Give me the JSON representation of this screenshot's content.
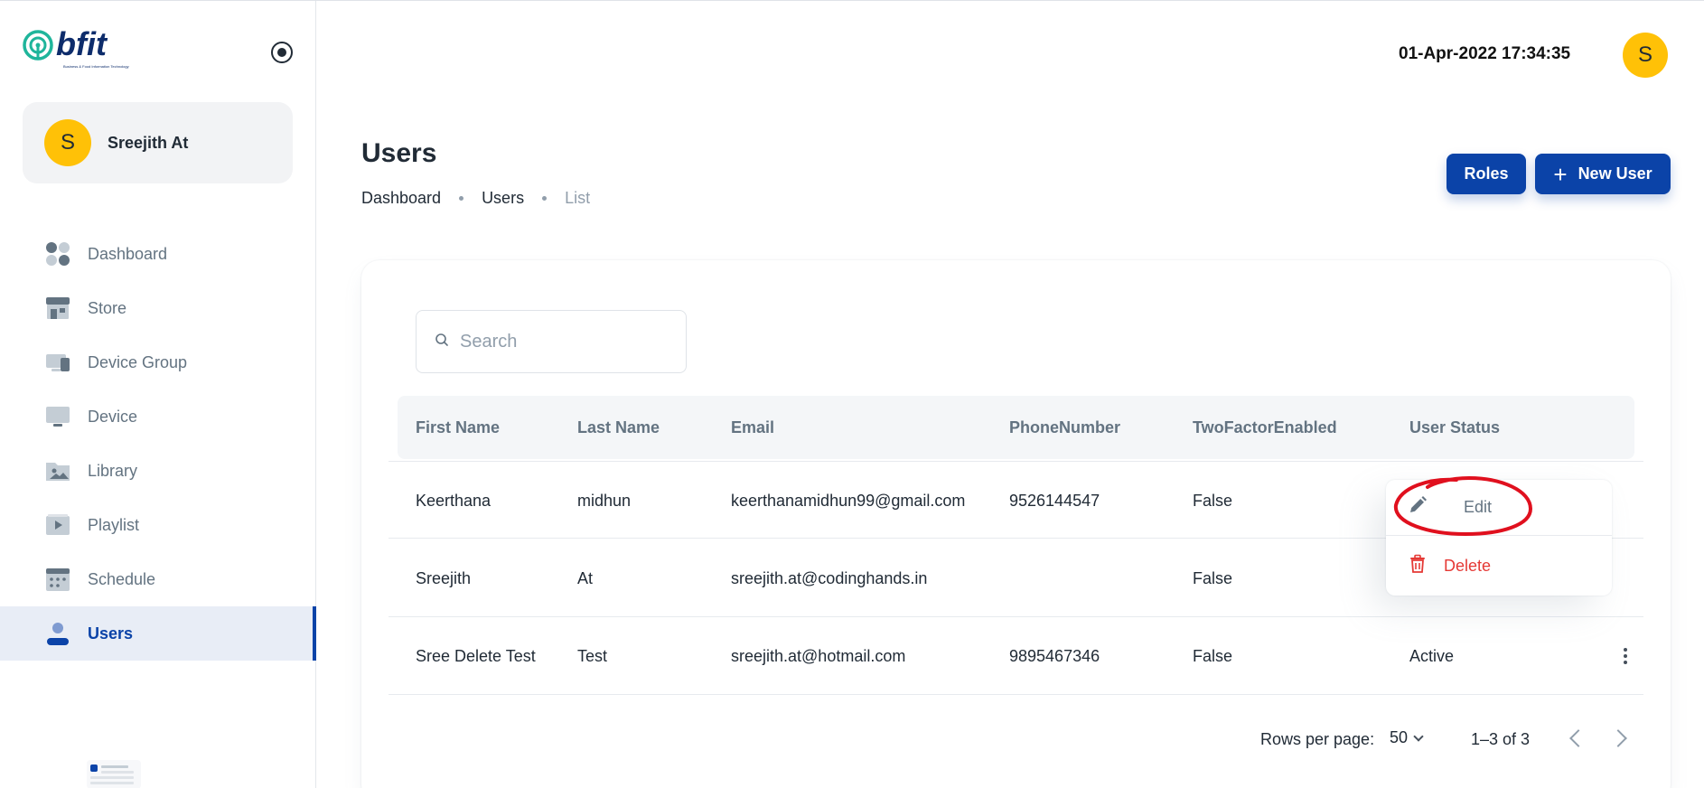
{
  "sidebar": {
    "logo_text": "bfit",
    "logo_tagline": "Business & Food Information Technology",
    "account": {
      "avatar_initial": "S",
      "name": "Sreejith At"
    },
    "items": [
      {
        "label": "Dashboard",
        "icon": "dashboard-icon"
      },
      {
        "label": "Store",
        "icon": "store-icon"
      },
      {
        "label": "Device Group",
        "icon": "device-group-icon"
      },
      {
        "label": "Device",
        "icon": "device-icon"
      },
      {
        "label": "Library",
        "icon": "library-icon"
      },
      {
        "label": "Playlist",
        "icon": "playlist-icon"
      },
      {
        "label": "Schedule",
        "icon": "schedule-icon"
      },
      {
        "label": "Users",
        "icon": "user-icon",
        "active": true
      }
    ]
  },
  "header": {
    "datetime": "01-Apr-2022 17:34:35",
    "avatar_initial": "S"
  },
  "page": {
    "title": "Users",
    "breadcrumb": [
      "Dashboard",
      "Users",
      "List"
    ],
    "roles_label": "Roles",
    "new_user_label": "New User"
  },
  "search": {
    "placeholder": "Search"
  },
  "table": {
    "columns": [
      "First Name",
      "Last Name",
      "Email",
      "PhoneNumber",
      "TwoFactorEnabled",
      "User Status"
    ],
    "rows": [
      {
        "first": "Keerthana",
        "last": "midhun",
        "email": "keerthanamidhun99@gmail.com",
        "phone": "9526144547",
        "twofactor": "False",
        "status": ""
      },
      {
        "first": "Sreejith",
        "last": "At",
        "email": "sreejith.at@codinghands.in",
        "phone": "",
        "twofactor": "False",
        "status": ""
      },
      {
        "first": "Sree Delete Test",
        "last": "Test",
        "email": "sreejith.at@hotmail.com",
        "phone": "9895467346",
        "twofactor": "False",
        "status": "Active"
      }
    ]
  },
  "pagination": {
    "rows_per_page_label": "Rows per page:",
    "rows_per_page": "50",
    "range": "1–3 of 3"
  },
  "menu": {
    "edit_label": "Edit",
    "delete_label": "Delete"
  },
  "colors": {
    "primary": "#0b43a8",
    "avatar": "#ffc107",
    "danger": "#e53935",
    "annotation": "#e0101e"
  }
}
